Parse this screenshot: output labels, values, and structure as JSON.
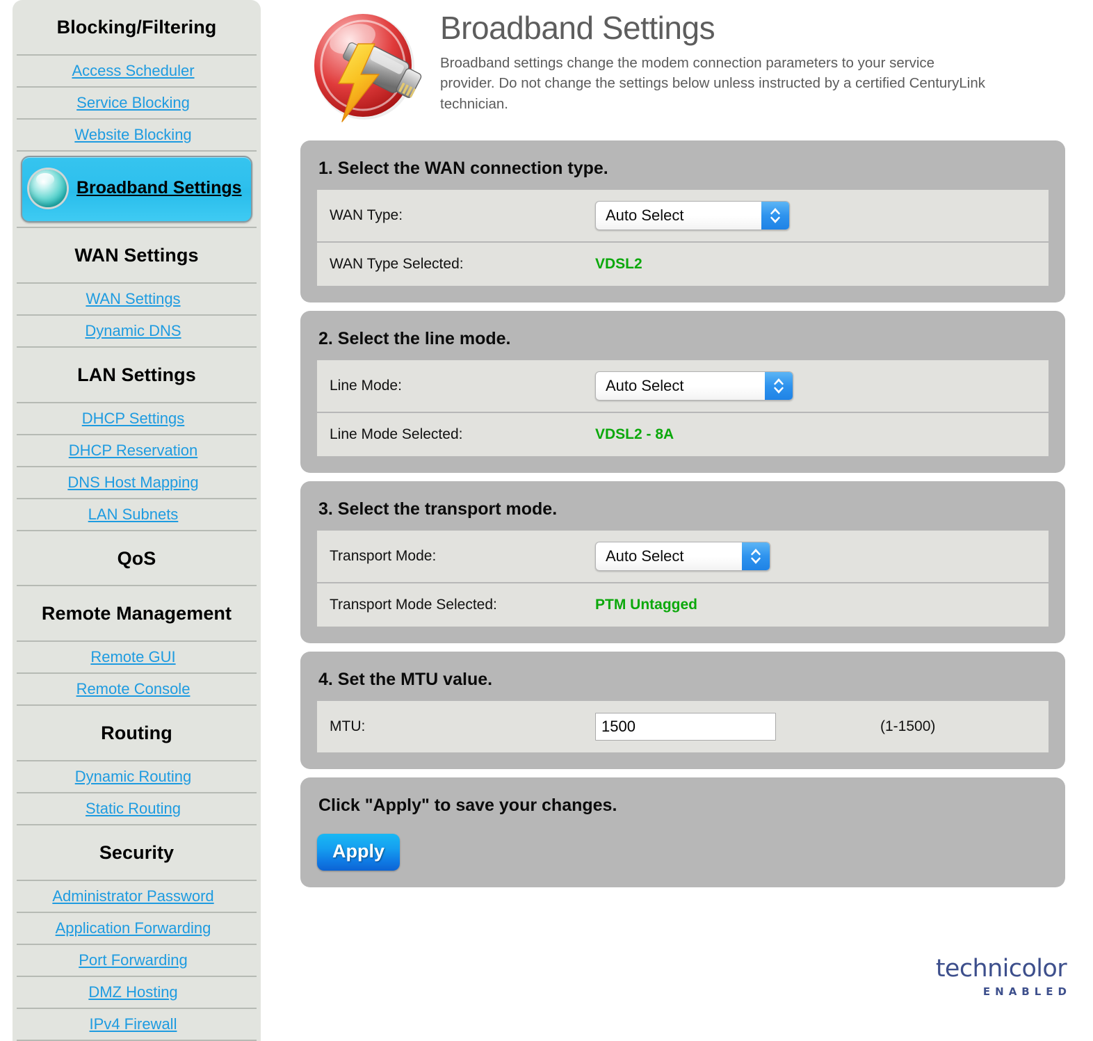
{
  "sidebar": {
    "groups": [
      {
        "header": "Blocking/Filtering",
        "links": [
          "Access Scheduler",
          "Service Blocking",
          "Website Blocking"
        ],
        "selected": {
          "label": "Broadband Settings",
          "icon": "orb-icon"
        }
      },
      {
        "header": "WAN Settings",
        "links": [
          "WAN Settings",
          "Dynamic DNS"
        ]
      },
      {
        "header": "LAN Settings",
        "links": [
          "DHCP Settings",
          "DHCP Reservation",
          "DNS Host Mapping",
          "LAN Subnets"
        ]
      },
      {
        "header": "QoS",
        "links": []
      },
      {
        "header": "Remote Management",
        "links": [
          "Remote GUI",
          "Remote Console"
        ]
      },
      {
        "header": "Routing",
        "links": [
          "Dynamic Routing",
          "Static Routing"
        ]
      },
      {
        "header": "Security",
        "links": [
          "Administrator Password",
          "Application Forwarding",
          "Port Forwarding",
          "DMZ Hosting",
          "IPv4 Firewall"
        ]
      }
    ]
  },
  "header": {
    "icon": "broadband-plug-icon",
    "title": "Broadband Settings",
    "description": "Broadband settings change the modem connection parameters to your service provider. Do not change the settings below unless instructed by a certified CenturyLink technician."
  },
  "panels": {
    "wan": {
      "title": "1. Select the WAN connection type.",
      "select_label": "WAN Type:",
      "select_value": "Auto Select",
      "selected_label": "WAN Type Selected:",
      "selected_value": "VDSL2"
    },
    "line": {
      "title": "2. Select the line mode.",
      "select_label": "Line Mode:",
      "select_value": "Auto Select",
      "selected_label": "Line Mode Selected:",
      "selected_value": "VDSL2 - 8A"
    },
    "transport": {
      "title": "3. Select the transport mode.",
      "select_label": "Transport Mode:",
      "select_value": "Auto Select",
      "selected_label": "Transport Mode Selected:",
      "selected_value": "PTM Untagged"
    },
    "mtu": {
      "title": "4. Set the MTU value.",
      "label": "MTU:",
      "value": "1500",
      "hint": "(1-1500)"
    },
    "apply": {
      "title": "Click \"Apply\" to save your changes.",
      "button_label": "Apply"
    }
  },
  "brand": {
    "name": "technicolor",
    "tagline": "ENABLED",
    "color": "#3d4f8c"
  },
  "colors": {
    "link": "#1e9be0",
    "status_green": "#0ba80b",
    "panel_bg": "#b7b7b7",
    "row_bg": "#e2e2de",
    "sidebar_bg": "#e2e4df",
    "selected_item": "#2ec0ed"
  }
}
